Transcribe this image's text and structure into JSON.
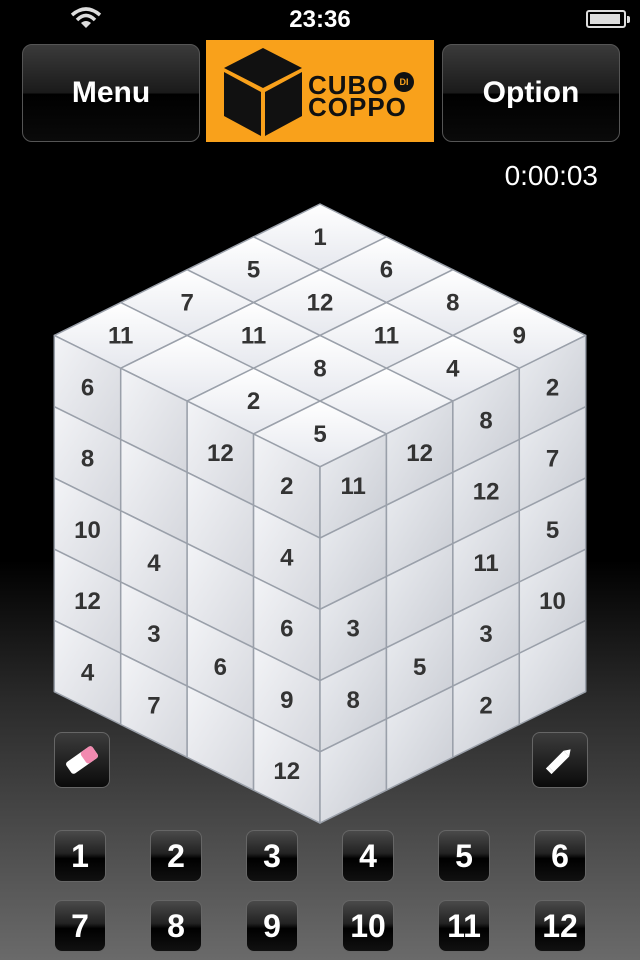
{
  "status_bar": {
    "time": "23:36",
    "wifi_icon": "wifi-icon",
    "battery_icon": "battery-icon"
  },
  "header": {
    "menu_label": "Menu",
    "option_label": "Option",
    "logo": {
      "line1": "CUBO",
      "line2": "COPPO",
      "badge": "DI",
      "color": "#f9a11b"
    }
  },
  "timer": "0:00:03",
  "cube": {
    "top_face": [
      [
        "1",
        "6",
        "8",
        "9"
      ],
      [
        "5",
        "12",
        "11",
        "4"
      ],
      [
        "7",
        "11",
        "8",
        ""
      ],
      [
        "11",
        "",
        "2",
        "5"
      ]
    ],
    "top_face_extra": [
      "9",
      "11"
    ],
    "left_face": [
      [
        "6",
        "",
        "12",
        "2"
      ],
      [
        "8",
        "",
        "",
        "4"
      ],
      [
        "10",
        "4",
        "",
        "6"
      ],
      [
        "12",
        "3",
        "6",
        "9"
      ],
      [
        "4",
        "7",
        "",
        "12"
      ]
    ],
    "right_face": [
      [
        "11",
        "12",
        "8",
        "2"
      ],
      [
        "",
        "",
        "12",
        "7"
      ],
      [
        "3",
        "",
        "11",
        "5"
      ],
      [
        "8",
        "5",
        "3",
        "10"
      ],
      [
        "",
        "",
        "2",
        ""
      ]
    ],
    "visible_numbers_left": [
      "6",
      "8",
      "10",
      "12",
      "4",
      "3",
      "7",
      "6",
      "9",
      "12",
      "12",
      "2",
      "4",
      "4",
      "6",
      "2"
    ],
    "visible_numbers_right": [
      "11",
      "12",
      "8",
      "2",
      "4",
      "12",
      "7",
      "3",
      "11",
      "5",
      "10",
      "3",
      "2",
      "5",
      "8"
    ]
  },
  "tools": {
    "eraser_icon": "eraser-icon",
    "pencil_icon": "pencil-icon"
  },
  "keypad": [
    "1",
    "2",
    "3",
    "4",
    "5",
    "6",
    "7",
    "8",
    "9",
    "10",
    "11",
    "12"
  ]
}
